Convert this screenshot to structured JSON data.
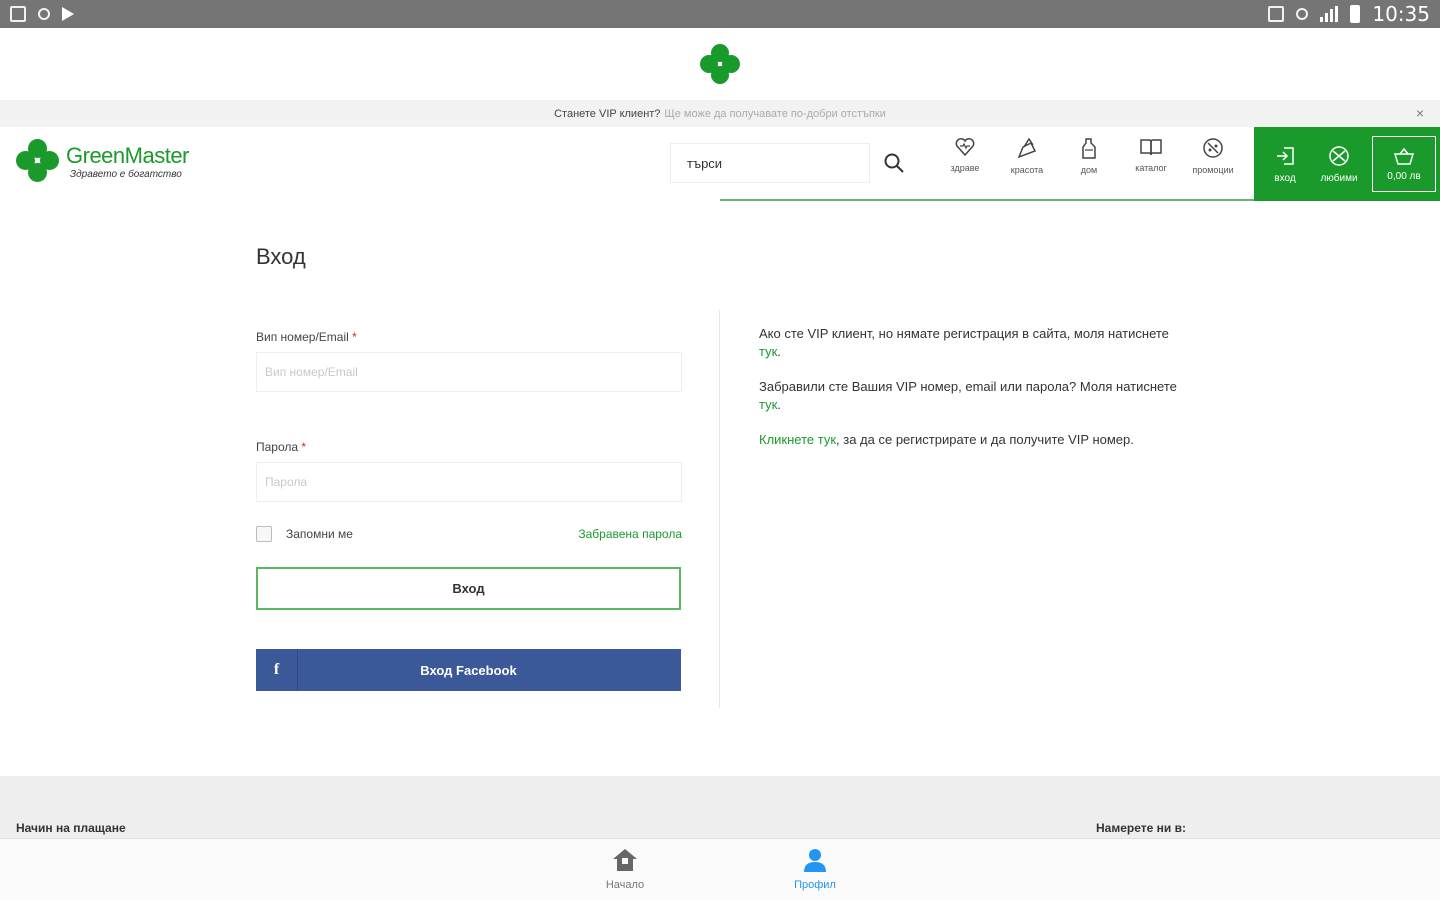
{
  "status_bar": {
    "time": "10:35"
  },
  "promo": {
    "bold_text": "Станете VIP клиент?",
    "muted_text": "Ще може да получавате по-добри отстъпки",
    "close": "×"
  },
  "header": {
    "logo_title": "GreenMaster",
    "logo_subtitle": "Здравето е богатство",
    "search_placeholder": "търси",
    "nav": [
      {
        "label": "здраве",
        "icon": "heart-icon"
      },
      {
        "label": "красота",
        "icon": "lipstick-icon"
      },
      {
        "label": "дом",
        "icon": "bottle-icon"
      },
      {
        "label": "каталог",
        "icon": "book-icon"
      },
      {
        "label": "промоции",
        "icon": "percent-icon"
      }
    ],
    "login_label": "вход",
    "wishlist_label": "любими",
    "cart_label": "0,00 лв"
  },
  "main": {
    "title": "Вход",
    "username_label": "Вип номер/Email",
    "username_placeholder": "Вип номер/Email",
    "password_label": "Парола",
    "password_placeholder": "Парола",
    "required_mark": "*",
    "remember_label": "Запомни ме",
    "forgot_label": "Забравена парола",
    "login_button": "Вход",
    "facebook_button": "Вход Facebook",
    "facebook_icon_glyph": "f"
  },
  "info": {
    "p1_text": "Ако сте VIP клиент, но нямате регистрация в сайта, моля натиснете ",
    "p1_link": "тук",
    "p1_end": ".",
    "p2_text": "Забравили сте Вашия VIP номер, email или парола? Моля натиснете ",
    "p2_link": "тук",
    "p2_end": ".",
    "p3_link": "Кликнете тук",
    "p3_text": ", за да се регистрирате и да получите VIP номер."
  },
  "footer": {
    "payment_heading": "Начин на плащане",
    "find_us_heading": "Намерете ни в:"
  },
  "bottom_nav": [
    {
      "label": "Начало",
      "icon": "home-icon",
      "active": false
    },
    {
      "label": "Профил",
      "icon": "profile-icon",
      "active": true
    }
  ],
  "colors": {
    "brand_green": "#1b9a2c",
    "facebook_blue": "#3b5998",
    "active_blue": "#2196f3"
  }
}
